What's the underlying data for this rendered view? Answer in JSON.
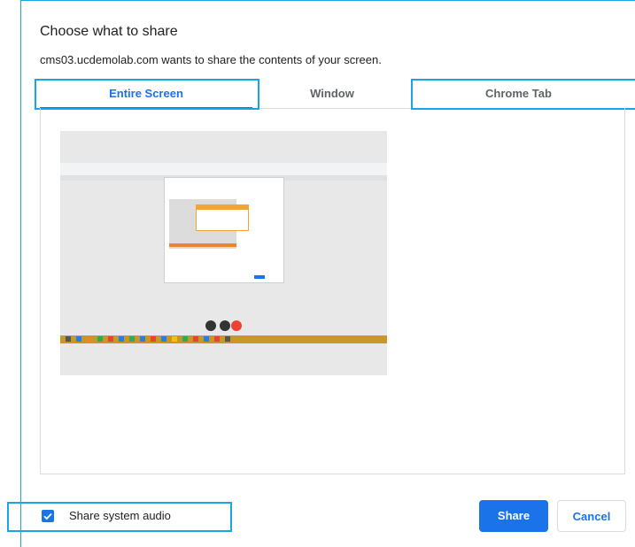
{
  "dialog": {
    "title": "Choose what to share",
    "subtitle": "cms03.ucdemolab.com wants to share the contents of your screen."
  },
  "tabs": [
    {
      "label": "Entire Screen",
      "active": true
    },
    {
      "label": "Window",
      "active": false
    },
    {
      "label": "Chrome Tab",
      "active": false
    }
  ],
  "audio": {
    "label": "Share system audio",
    "checked": true
  },
  "buttons": {
    "share": "Share",
    "cancel": "Cancel"
  },
  "colors": {
    "accent": "#1a73e8",
    "annotation": "#1aa3e8"
  }
}
